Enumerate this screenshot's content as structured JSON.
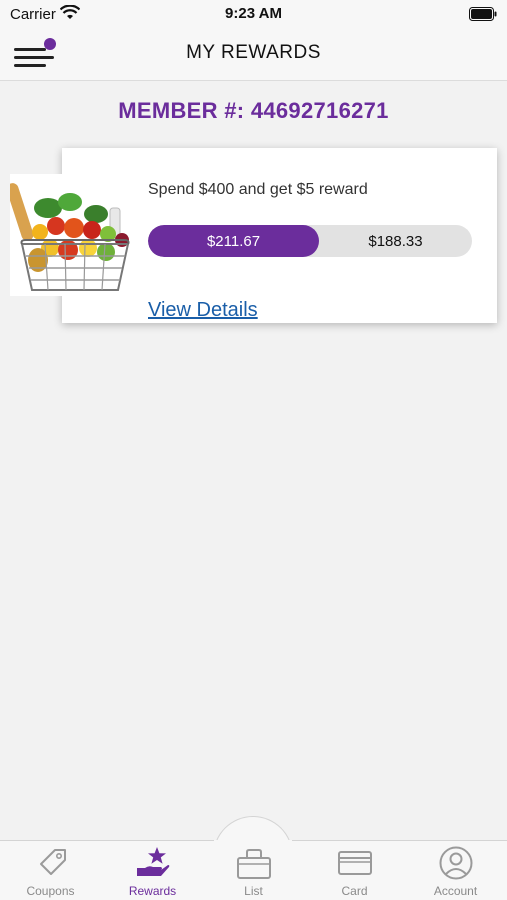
{
  "status_bar": {
    "carrier": "Carrier",
    "time": "9:23 AM"
  },
  "header": {
    "title": "MY REWARDS"
  },
  "member": {
    "label": "MEMBER #: 44692716271"
  },
  "reward": {
    "title": "Spend $400 and get $5 reward",
    "spent": "$211.67",
    "remaining": "$188.33",
    "progress_fraction": 0.529,
    "link_label": "View Details",
    "image_icon": "grocery-basket"
  },
  "tabs": [
    {
      "label": "Coupons",
      "icon": "tag-icon",
      "active": false
    },
    {
      "label": "Rewards",
      "icon": "rewards-icon",
      "active": true
    },
    {
      "label": "List",
      "icon": "basket-icon",
      "active": false
    },
    {
      "label": "Card",
      "icon": "card-icon",
      "active": false
    },
    {
      "label": "Account",
      "icon": "account-icon",
      "active": false
    }
  ],
  "colors": {
    "accent": "#6b2d9c",
    "link": "#1a5ea8"
  }
}
